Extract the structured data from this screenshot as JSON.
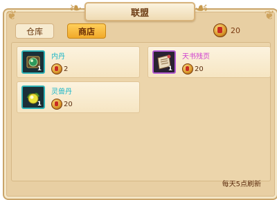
{
  "title": "联盟",
  "tabs": [
    {
      "label": "仓库",
      "active": false
    },
    {
      "label": "商店",
      "active": true
    }
  ],
  "currency": {
    "icon": "alliance-token-icon",
    "amount": "20"
  },
  "items": [
    {
      "name": "内丹",
      "qty": "1",
      "price": "2",
      "rarity_color": "#19b5c7",
      "icon": "inner-pill-icon"
    },
    {
      "name": "天书残页",
      "qty": "1",
      "price": "20",
      "rarity_color": "#cf3ed0",
      "icon": "scroll-page-icon"
    },
    {
      "name": "灵兽丹",
      "qty": "1",
      "price": "20",
      "rarity_color": "#19b5c7",
      "icon": "spirit-beast-pill-icon"
    }
  ],
  "refresh_note": "每天5点刷新"
}
